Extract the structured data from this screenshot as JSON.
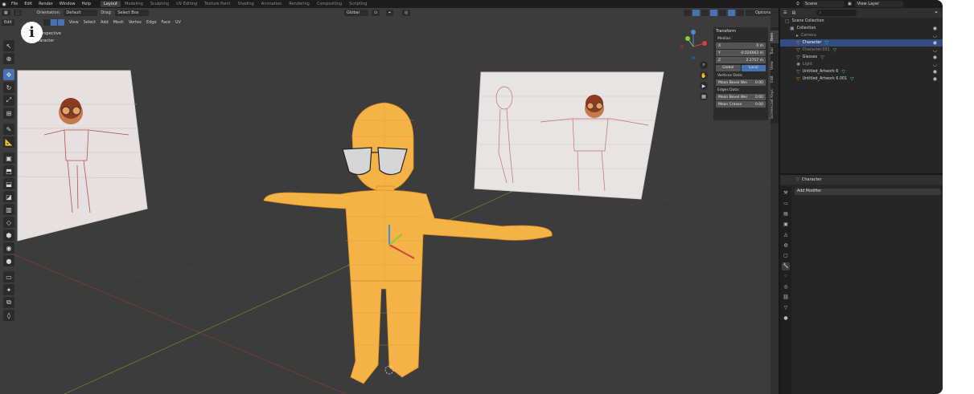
{
  "app": {
    "menu": [
      "File",
      "Edit",
      "Render",
      "Window",
      "Help"
    ],
    "workspaces": [
      "Layout",
      "Modeling",
      "Sculpting",
      "UV Editing",
      "Texture Paint",
      "Shading",
      "Animation",
      "Rendering",
      "Compositing",
      "Scripting"
    ],
    "active_workspace": "Layout",
    "scene": "Scene",
    "view_layer": "View Layer"
  },
  "viewport": {
    "orientation_label": "Orientation:",
    "orientation_value": "Default",
    "drag_label": "Drag:",
    "drag_value": "Select Box",
    "transform_orientation": "Global",
    "menus": [
      "View",
      "Select",
      "Add",
      "Mesh",
      "Vertex",
      "Edge",
      "Face",
      "UV"
    ],
    "mode": "Edit",
    "info_line1": "User Perspective",
    "info_line2": "(1) Character",
    "options": "Options"
  },
  "npanel": {
    "title": "Transform",
    "median_label": "Median:",
    "x_label": "X",
    "x_value": "0 m",
    "y_label": "Y",
    "y_value": "-0.024663 m",
    "z_label": "Z",
    "z_value": "2.2757 m",
    "global": "Global",
    "local": "Local",
    "vertices_data": "Vertices Data:",
    "mean_bevel_weight": "Mean Bevel Wei",
    "bevel_weight_value": "0.00",
    "edges_data": "Edges Data:",
    "mean_bevel_weight2": "Mean Bevel Wei",
    "bevel_weight_value2": "0.00",
    "mean_crease": "Mean Crease",
    "crease_value": "0.00",
    "side_tabs": [
      "Item",
      "Tool",
      "View",
      "Edit",
      "Screencast Keys"
    ]
  },
  "outliner": {
    "rows": [
      {
        "label": "Scene Collection",
        "icon": "scene-collection-icon"
      },
      {
        "label": "Collection",
        "icon": "collection-icon"
      },
      {
        "label": "Camera",
        "icon": "camera-icon"
      },
      {
        "label": "Character",
        "icon": "mesh-icon"
      },
      {
        "label": "Character.001",
        "icon": "mesh-icon"
      },
      {
        "label": "Glasses",
        "icon": "mesh-icon"
      },
      {
        "label": "Light",
        "icon": "light-icon"
      },
      {
        "label": "Untitled_Artwork 6",
        "icon": "image-icon"
      },
      {
        "label": "Untitled_Artwork 6.001",
        "icon": "image-icon"
      }
    ]
  },
  "properties": {
    "object_name": "Character",
    "add_modifier": "Add Modifier"
  },
  "colors": {
    "accent": "#4772b3",
    "selection": "#334d80",
    "mesh_orange": "#f5b347",
    "wire_orange": "#e8a030"
  }
}
